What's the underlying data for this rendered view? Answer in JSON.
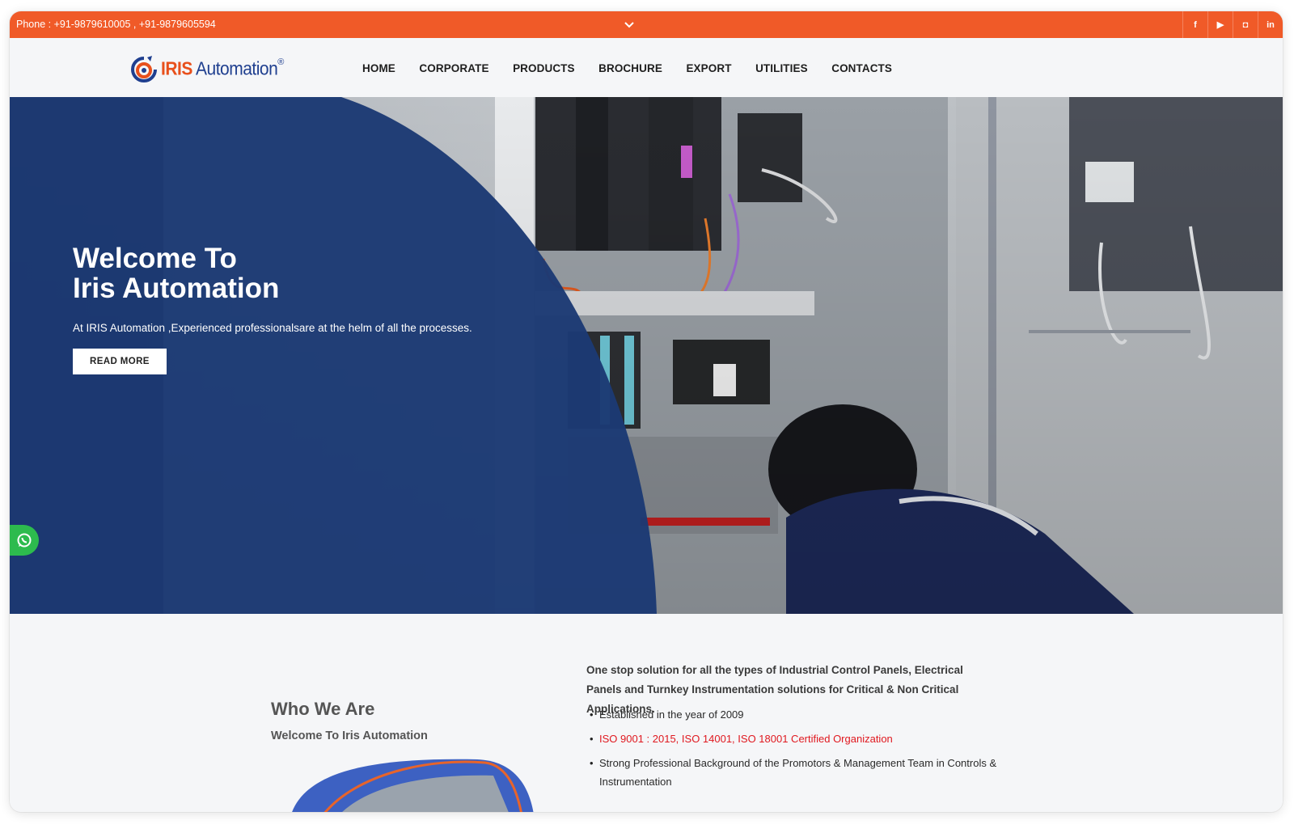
{
  "topbar": {
    "phone": "Phone : +91-9879610005  , +91-9879605594",
    "social_icons": [
      "facebook-icon",
      "youtube-icon",
      "instagram-icon",
      "linkedin-icon"
    ]
  },
  "brand": {
    "name_a": "IRIS",
    "name_b": "Automation",
    "registered": "®"
  },
  "nav": {
    "items": [
      "HOME",
      "CORPORATE",
      "PRODUCTS",
      "BROCHURE",
      "EXPORT",
      "UTILITIES",
      "CONTACTS"
    ]
  },
  "hero": {
    "title_line1": "Welcome To",
    "title_line2": "Iris Automation",
    "subtitle": "At IRIS Automation ,Experienced professionalsare at the helm of all the processes.",
    "button": "READ MORE"
  },
  "about": {
    "heading": "Who We Are",
    "subheading": "Welcome To Iris Automation",
    "lead": "One stop solution for all the types of Industrial Control Panels, Electrical Panels and Turnkey Instrumentation solutions for Critical & Non Critical Applications.",
    "bullets": [
      "Established in the year of 2009",
      "ISO 9001 : 2015, ISO 14001, ISO 18001 Certified Organization",
      "Strong Professional Background of the Promotors & Management Team in Controls & Instrumentation"
    ]
  },
  "colors": {
    "accent": "#f05a28",
    "hero_navy": "#1c3a74",
    "highlight_red": "#e0181f",
    "whatsapp": "#2dbb4e"
  }
}
